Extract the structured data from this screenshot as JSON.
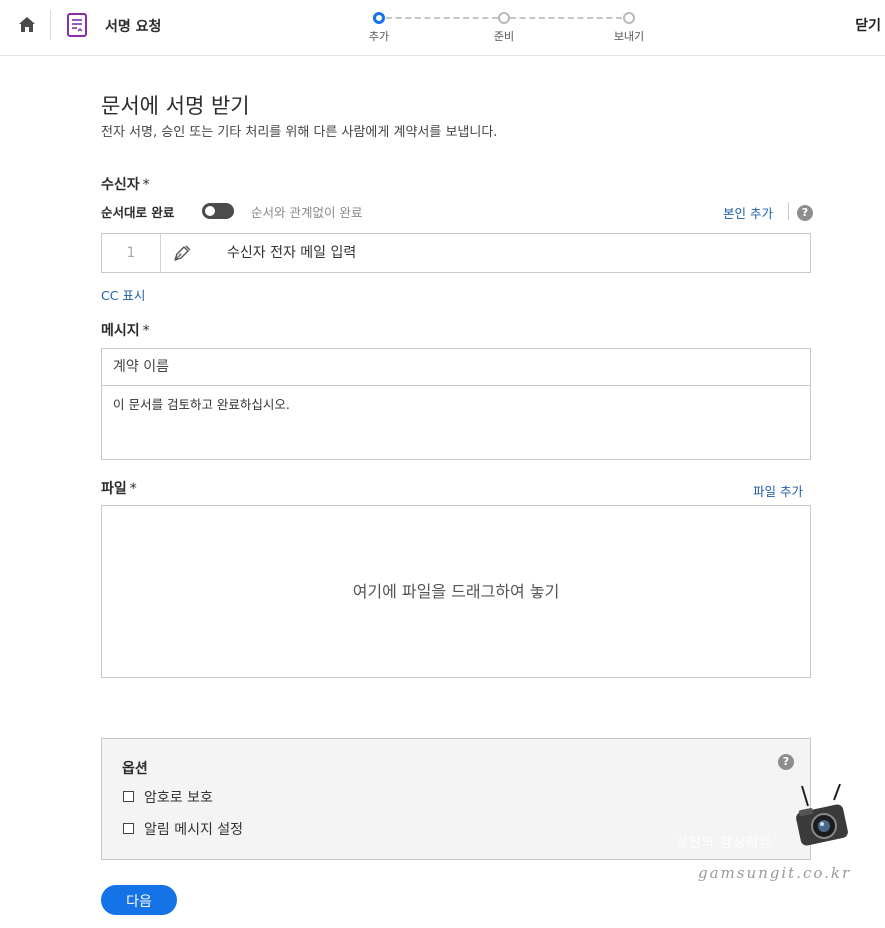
{
  "header": {
    "title": "서명 요청",
    "close_label": "닫기",
    "steps": [
      {
        "label": "추가",
        "active": true
      },
      {
        "label": "준비",
        "active": false
      },
      {
        "label": "보내기",
        "active": false
      }
    ]
  },
  "page": {
    "title": "문서에 서명 받기",
    "subtitle": "전자 서명, 승인 또는 기타 처리를 위해 다른 사람에게 계약서를 보냅니다."
  },
  "recipients": {
    "title": "수신자",
    "required_mark": "*",
    "order_label": "순서대로 완료",
    "order_off_label": "순서와 관계없이 완료",
    "add_me_link": "본인 추가",
    "row_number": "1",
    "email_placeholder": "수신자 전자 메일 입력",
    "cc_link": "CC 표시"
  },
  "message": {
    "title": "메시지",
    "required_mark": "*",
    "name_placeholder": "계약 이름",
    "body": "이 문서를 검토하고 완료하십시오."
  },
  "files": {
    "title": "파일",
    "required_mark": "*",
    "add_link": "파일 추가",
    "drop_text": "여기에 파일을 드래그하여 놓기"
  },
  "options": {
    "title": "옵션",
    "items": [
      {
        "label": "암호로 보호",
        "checked": false
      },
      {
        "label": "알림 메시지 설정",
        "checked": false
      }
    ]
  },
  "help_glyph": "?",
  "next_label": "다음",
  "watermark": {
    "text": "꽃잔의 감성리뷰",
    "url": "gamsungit.co.kr"
  },
  "colors": {
    "accent": "#1473e6",
    "link": "#1d5fa8",
    "doc_icon": "#8a2da8"
  }
}
